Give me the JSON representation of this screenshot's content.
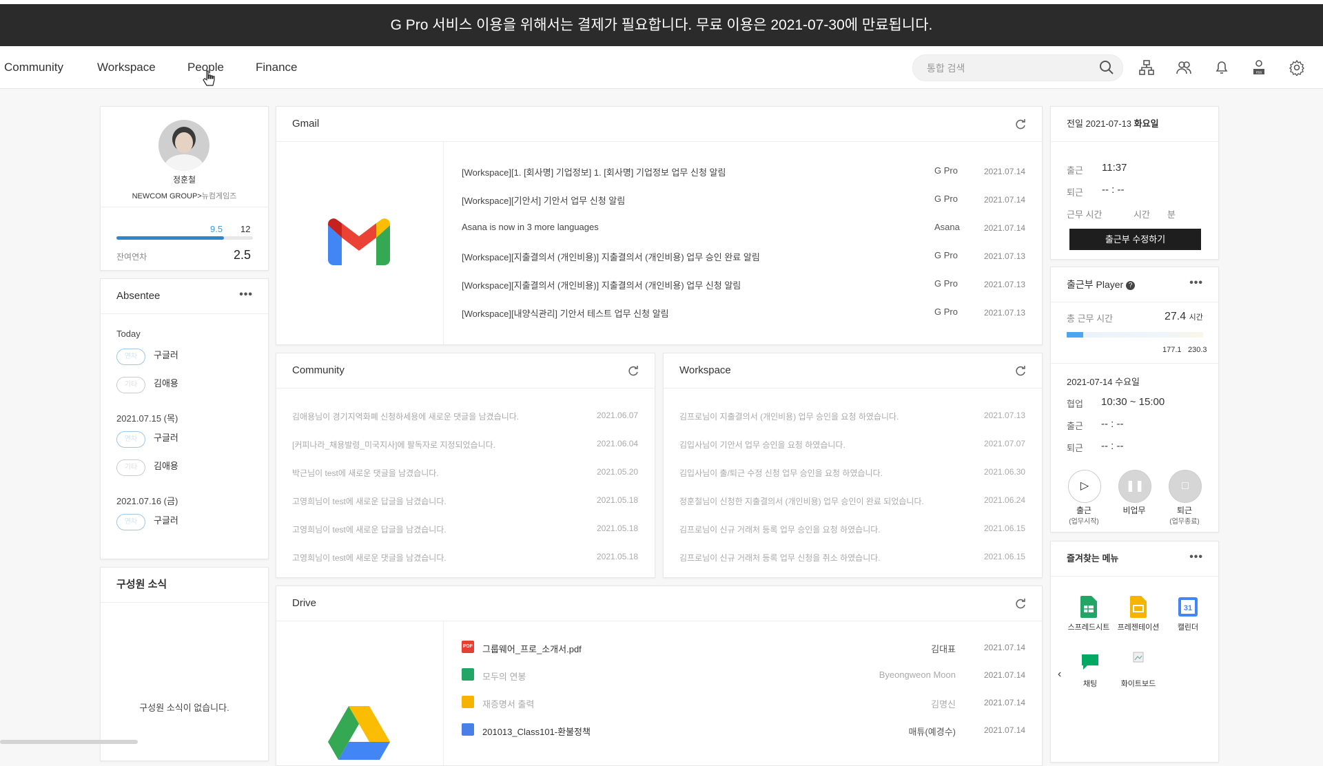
{
  "banner": {
    "text": "G Pro 서비스 이용을 위해서는 결제가 필요합니다. 무료 이용은 2021-07-30에 만료됩니다."
  },
  "nav": {
    "items": [
      "Community",
      "Workspace",
      "People",
      "Finance"
    ],
    "search_placeholder": "통합 검색"
  },
  "profile": {
    "name": "정훈철",
    "org_main": "NEWCOM GROUP>",
    "org_sub": "뉴컴게임즈",
    "used": "9.5",
    "total": "12",
    "remaining_label": "잔여연차",
    "remaining_value": "2.5",
    "used_fraction": 0.79
  },
  "absentee": {
    "title": "Absentee",
    "groups": [
      {
        "label": "Today",
        "entries": [
          {
            "badge": "연차",
            "name": "구글러"
          },
          {
            "badge": "기타",
            "name": "김애용"
          }
        ]
      },
      {
        "label": "2021.07.15 (목)",
        "entries": [
          {
            "badge": "연차",
            "name": "구글러"
          },
          {
            "badge": "기타",
            "name": "김애용"
          }
        ]
      },
      {
        "label": "2021.07.16 (금)",
        "entries": [
          {
            "badge": "연차",
            "name": "구글러"
          }
        ]
      }
    ]
  },
  "members": {
    "title": "구성원 소식",
    "empty": "구성원 소식이 없습니다."
  },
  "gmail": {
    "title": "Gmail",
    "rows": [
      {
        "subject": "[Workspace][1. [회사명] 기업정보] 1. [회사명] 기업정보 업무 신청 알림",
        "sender": "G Pro",
        "date": "2021.07.14"
      },
      {
        "subject": "[Workspace][기안서] 기안서 업무 신청 알림",
        "sender": "G Pro",
        "date": "2021.07.14"
      },
      {
        "subject": "Asana is now in 3 more languages",
        "sender": "Asana",
        "date": "2021.07.14"
      },
      {
        "subject": "[Workspace][지출결의서 (개인비용)] 지출결의서 (개인비용) 업무 승인 완료 알림",
        "sender": "G Pro",
        "date": "2021.07.13"
      },
      {
        "subject": "[Workspace][지출결의서 (개인비용)] 지출결의서 (개인비용) 업무 신청 알림",
        "sender": "G Pro",
        "date": "2021.07.13"
      },
      {
        "subject": "[Workspace][내양식관리] 기안서 테스트 업무 신청 알림",
        "sender": "G Pro",
        "date": "2021.07.13"
      }
    ]
  },
  "community": {
    "title": "Community",
    "rows": [
      {
        "text": "김애용님이 경기지역화폐 신청하세용에 새로운 댓글을 남겼습니다.",
        "date": "2021.06.07"
      },
      {
        "text": "[커피나라_채용발령_미국지사]에 팔독자로 지정되었습니다.",
        "date": "2021.06.04"
      },
      {
        "text": "박근님이 test에 새로운 댓글을 남겼습니다.",
        "date": "2021.05.20"
      },
      {
        "text": "고영희님이 test에 새로운 답글을 남겼습니다.",
        "date": "2021.05.18"
      },
      {
        "text": "고영희님이 test에 새로운 답글을 남겼습니다.",
        "date": "2021.05.18"
      },
      {
        "text": "고영희님이 test에 새로운 댓글을 남겼습니다.",
        "date": "2021.05.18"
      }
    ]
  },
  "workspace": {
    "title": "Workspace",
    "rows": [
      {
        "text": "김프로님이 지출결의서 (개인비용) 업무 승인을 요청 하였습니다.",
        "date": "2021.07.13"
      },
      {
        "text": "김입사님이 기안서 업무 승인을 요청 하였습니다.",
        "date": "2021.07.07"
      },
      {
        "text": "김입사님이 출/퇴근 수정 신청 업무 승인을 요청 하였습니다.",
        "date": "2021.06.30"
      },
      {
        "text": "정훈철님이 신청한 지출결의서 (개인비용) 업무 승인이 완료 되었습니다.",
        "date": "2021.06.24"
      },
      {
        "text": "김프로님이 신규 거래처 등록 업무 승인을 요청 하였습니다.",
        "date": "2021.06.15"
      },
      {
        "text": "김프로님이 신규 거래처 등록 업무 신청을 취소 하였습니다.",
        "date": "2021.06.15"
      }
    ]
  },
  "drive": {
    "title": "Drive",
    "rows": [
      {
        "name": "그룹웨어_프로_소개서.pdf",
        "owner": "김대표",
        "date": "2021.07.14",
        "icon": "pdf-file-icon"
      },
      {
        "name": "모두의 연봉",
        "owner": "Byeongweon Moon",
        "date": "2021.07.14",
        "icon": "sheets-file-icon"
      },
      {
        "name": "재증명서 출력",
        "owner": "김명신",
        "date": "2021.07.14",
        "icon": "slides-file-icon"
      },
      {
        "name": "201013_Class101-환불정책",
        "owner": "매튜(예경수)",
        "date": "2021.07.14",
        "icon": "docs-file-icon"
      }
    ]
  },
  "attendance": {
    "title_prefix": "전일 2021-07-13 ",
    "title_day": "화요일",
    "in_label": "출근",
    "in_value": "11:37",
    "out_label": "퇴근",
    "out_value": "-- : --",
    "work_label": "근무 시간",
    "hour_label": "시간",
    "min_label": "분",
    "edit_button": "출근부 수정하기"
  },
  "player": {
    "title": "출근부 Player",
    "total_label": "총 근무 시간",
    "total_value": "27.4",
    "total_unit": "시간",
    "mark1": "177.1",
    "mark2": "230.3",
    "progress_fraction": 0.12,
    "date": "2021-07-14 수요일",
    "rows": [
      {
        "label": "협업",
        "value": "10:30 ~ 15:00"
      },
      {
        "label": "출근",
        "value": "-- : --"
      },
      {
        "label": "퇴근",
        "value": "-- : --"
      }
    ],
    "buttons": [
      {
        "label": "출근",
        "sub": "(업무시작)"
      },
      {
        "label": "비업무",
        "sub": ""
      },
      {
        "label": "퇴근",
        "sub": "(업무종료)"
      }
    ]
  },
  "favorites": {
    "title": "즐겨찾는 메뉴",
    "items": [
      "스프레드시트",
      "프레젠테이션",
      "캘린더",
      "채팅",
      "화이트보드"
    ]
  },
  "colors": {
    "accent": "#3b9be8",
    "banner": "#2b2b2b"
  }
}
